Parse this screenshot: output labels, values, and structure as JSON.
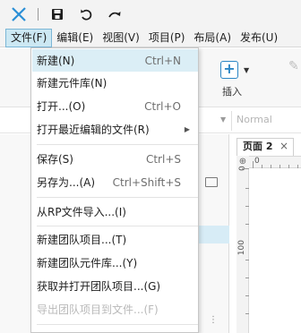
{
  "window": {
    "logo_icon": "axure-x-logo",
    "toolbar_icons": [
      "save-icon",
      "undo-icon",
      "redo-icon"
    ]
  },
  "menubar": {
    "items": [
      {
        "label": "文件(F)",
        "active": true
      },
      {
        "label": "编辑(E)"
      },
      {
        "label": "视图(V)"
      },
      {
        "label": "项目(P)"
      },
      {
        "label": "布局(A)"
      },
      {
        "label": "发布(U)"
      }
    ]
  },
  "file_menu": {
    "items": [
      {
        "label": "新建(N)",
        "shortcut": "Ctrl+N",
        "highlighted": true
      },
      {
        "label": "新建元件库(N)",
        "shortcut": ""
      },
      {
        "label": "打开...(O)",
        "shortcut": "Ctrl+O"
      },
      {
        "label": "打开最近编辑的文件(R)",
        "shortcut": "",
        "submenu": true
      },
      {
        "label": "保存(S)",
        "shortcut": "Ctrl+S"
      },
      {
        "label": "另存为...(A)",
        "shortcut": "Ctrl+Shift+S"
      },
      {
        "label": "从RP文件导入...(I)",
        "shortcut": ""
      },
      {
        "label": "新建团队项目...(T)",
        "shortcut": ""
      },
      {
        "label": "新建团队元件库...(Y)",
        "shortcut": ""
      },
      {
        "label": "获取并打开团队项目...(G)",
        "shortcut": ""
      },
      {
        "label": "导出团队项目到文件...(F)",
        "shortcut": "",
        "disabled": true
      }
    ]
  },
  "toolbar": {
    "insert_label": "插入",
    "insert_symbol": "+"
  },
  "style_bar": {
    "style_select": "Normal"
  },
  "canvas": {
    "page_tab": "页面 2",
    "tab_close": "×",
    "ruler_corner": "⊕",
    "ruler_top_zero": "0",
    "ruler_left_zero": "0",
    "ruler_left_100": "100"
  }
}
